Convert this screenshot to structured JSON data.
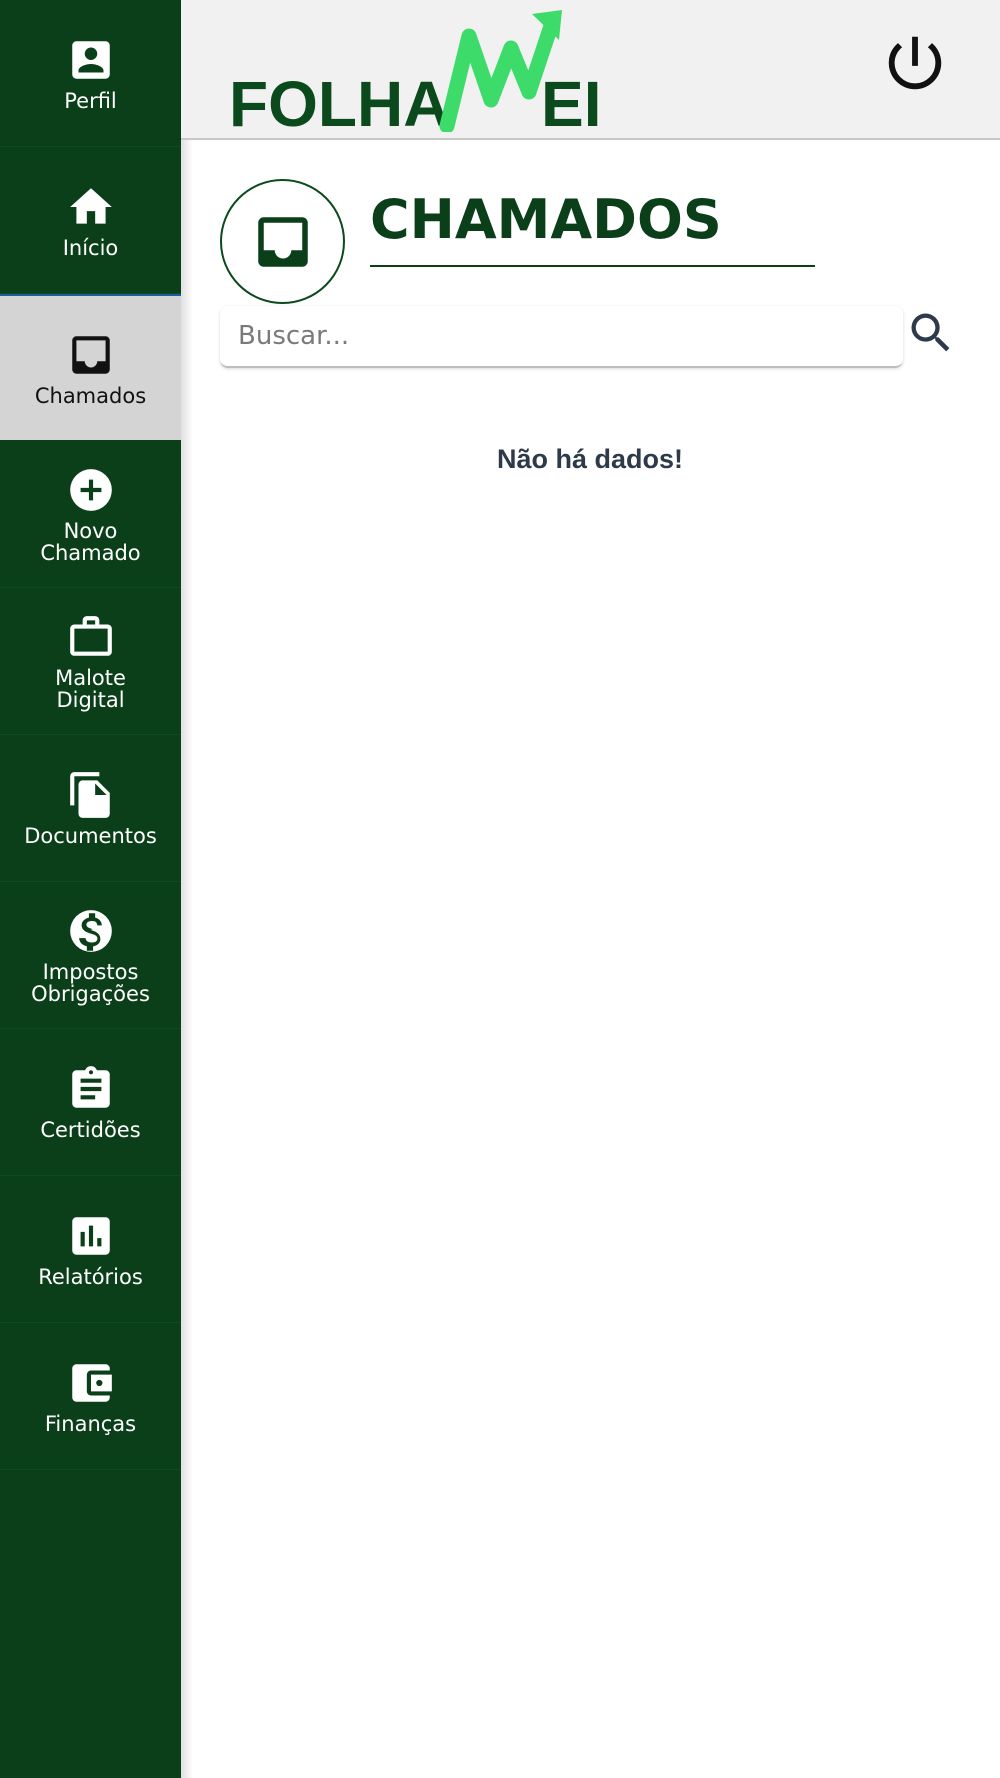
{
  "header": {
    "logo_text": "FOLHA",
    "logo_text_suffix": "EI",
    "logo_m": "M"
  },
  "sidebar": {
    "items": [
      {
        "label": "Perfil",
        "icon": "account-box-icon"
      },
      {
        "label": "Início",
        "icon": "home-icon"
      },
      {
        "label": "Chamados",
        "icon": "inbox-icon",
        "active": true
      },
      {
        "label": "Novo\nChamado",
        "icon": "add-circle-icon"
      },
      {
        "label": "Malote\nDigital",
        "icon": "briefcase-icon"
      },
      {
        "label": "Documentos",
        "icon": "file-copy-icon"
      },
      {
        "label": "Impostos\nObrigações",
        "icon": "dollar-circle-icon"
      },
      {
        "label": "Certidões",
        "icon": "clipboard-icon"
      },
      {
        "label": "Relatórios",
        "icon": "bar-chart-icon"
      },
      {
        "label": "Finanças",
        "icon": "wallet-icon"
      }
    ]
  },
  "main": {
    "title": "CHAMADOS",
    "search": {
      "placeholder": "Buscar..."
    },
    "empty_message": "Não há dados!"
  },
  "colors": {
    "sidebar_bg": "#0a3f19",
    "active_bg": "#d4d4d4",
    "header_bg": "#f1f1f1",
    "logo_green": "#0a4a1c",
    "logo_accent": "#3ddc6a"
  }
}
